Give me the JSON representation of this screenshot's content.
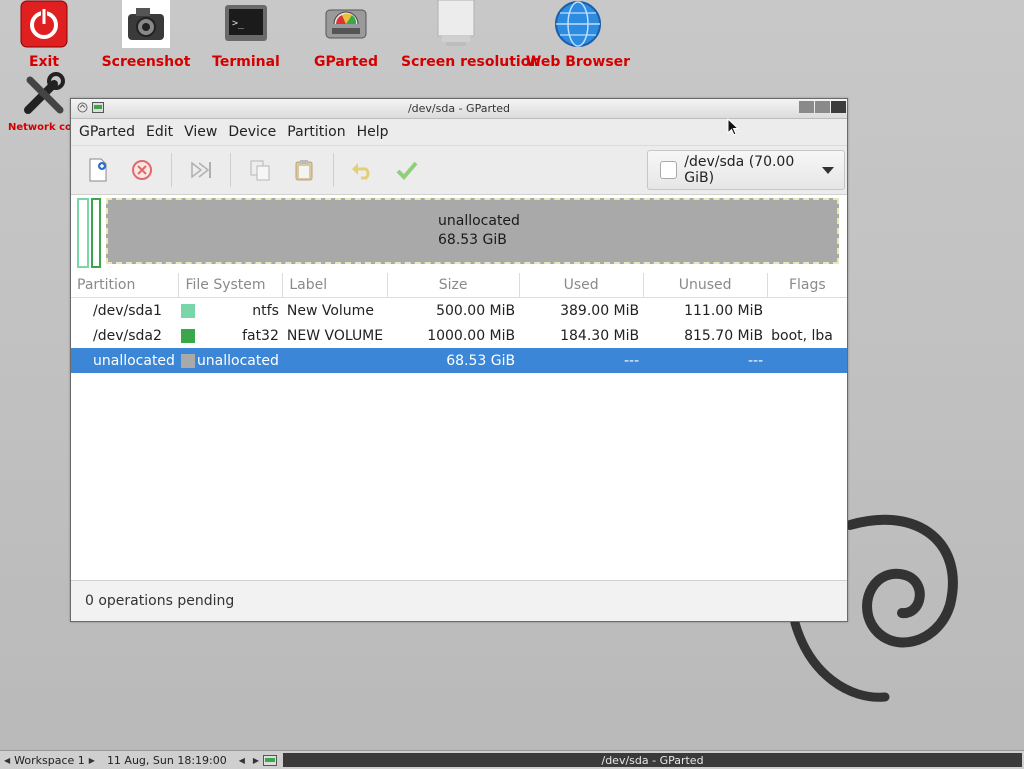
{
  "desktop": {
    "icons": [
      {
        "label": "Exit",
        "icon": "power-icon"
      },
      {
        "label": "Screenshot",
        "icon": "camera-icon"
      },
      {
        "label": "Terminal",
        "icon": "terminal-icon"
      },
      {
        "label": "GParted",
        "icon": "disk-icon"
      },
      {
        "label": "Screen resolution",
        "icon": "monitor-icon"
      },
      {
        "label": "Web Browser",
        "icon": "globe-icon"
      },
      {
        "label": "Network con",
        "icon": "tools-icon"
      }
    ],
    "label_color": "#d40000"
  },
  "window": {
    "title": "/dev/sda - GParted",
    "menu": [
      "GParted",
      "Edit",
      "View",
      "Device",
      "Partition",
      "Help"
    ],
    "device_selector": "/dev/sda (70.00 GiB)",
    "graph": {
      "label": "unallocated",
      "size": "68.53 GiB"
    },
    "columns": [
      "Partition",
      "File System",
      "Label",
      "Size",
      "Used",
      "Unused",
      "Flags"
    ],
    "rows": [
      {
        "partition": "/dev/sda1",
        "fs": "ntfs",
        "fs_color": "#79d6a8",
        "label": "New Volume",
        "size": "500.00 MiB",
        "used": "389.00 MiB",
        "unused": "111.00 MiB",
        "flags": ""
      },
      {
        "partition": "/dev/sda2",
        "fs": "fat32",
        "fs_color": "#3aa84a",
        "label": "NEW VOLUME",
        "size": "1000.00 MiB",
        "used": "184.30 MiB",
        "unused": "815.70 MiB",
        "flags": "boot, lba"
      },
      {
        "partition": "unallocated",
        "fs": "unallocated",
        "fs_color": "#a9a9a9",
        "label": "",
        "size": "68.53 GiB",
        "used": "---",
        "unused": "---",
        "flags": "",
        "selected": true
      }
    ],
    "status": "0 operations pending",
    "selection_color": "#3b86d6"
  },
  "panel": {
    "workspace": "Workspace 1",
    "clock": "11 Aug, Sun 18:19:00",
    "task": "/dev/sda - GParted"
  }
}
